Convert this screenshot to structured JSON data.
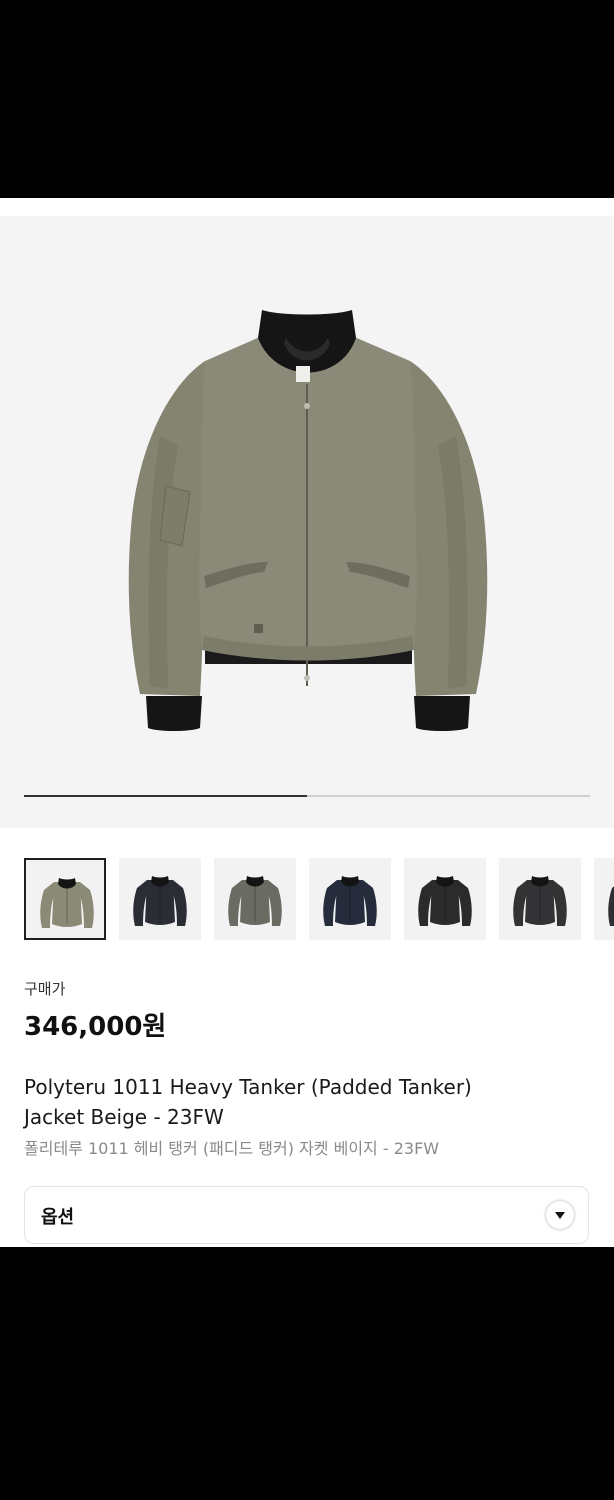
{
  "product": {
    "price_label": "구매가",
    "price": "346,000원",
    "title_en_line1": "Polyteru 1011 Heavy Tanker (Padded Tanker)",
    "title_en_line2": "Jacket Beige - 23FW",
    "title_ko": "폴리테루 1011 헤비 탱커 (패디드 탱커) 자켓 베이지 - 23FW"
  },
  "gallery": {
    "progress": 0.5,
    "thumbnails": [
      {
        "color": "#8a8a76",
        "selected": true
      },
      {
        "color": "#2a2d33",
        "selected": false
      },
      {
        "color": "#6a6b62",
        "selected": false
      },
      {
        "color": "#262c3b",
        "selected": false
      },
      {
        "color": "#2b2b2b",
        "selected": false
      },
      {
        "color": "#333335",
        "selected": false
      },
      {
        "color": "#2d2f35",
        "selected": false
      }
    ]
  },
  "option": {
    "label": "옵션",
    "icon": "chevron-down-icon"
  },
  "colors": {
    "jacket_main": "#8b8a78",
    "jacket_shadow": "#6f6e5e",
    "rib": "#151515"
  }
}
